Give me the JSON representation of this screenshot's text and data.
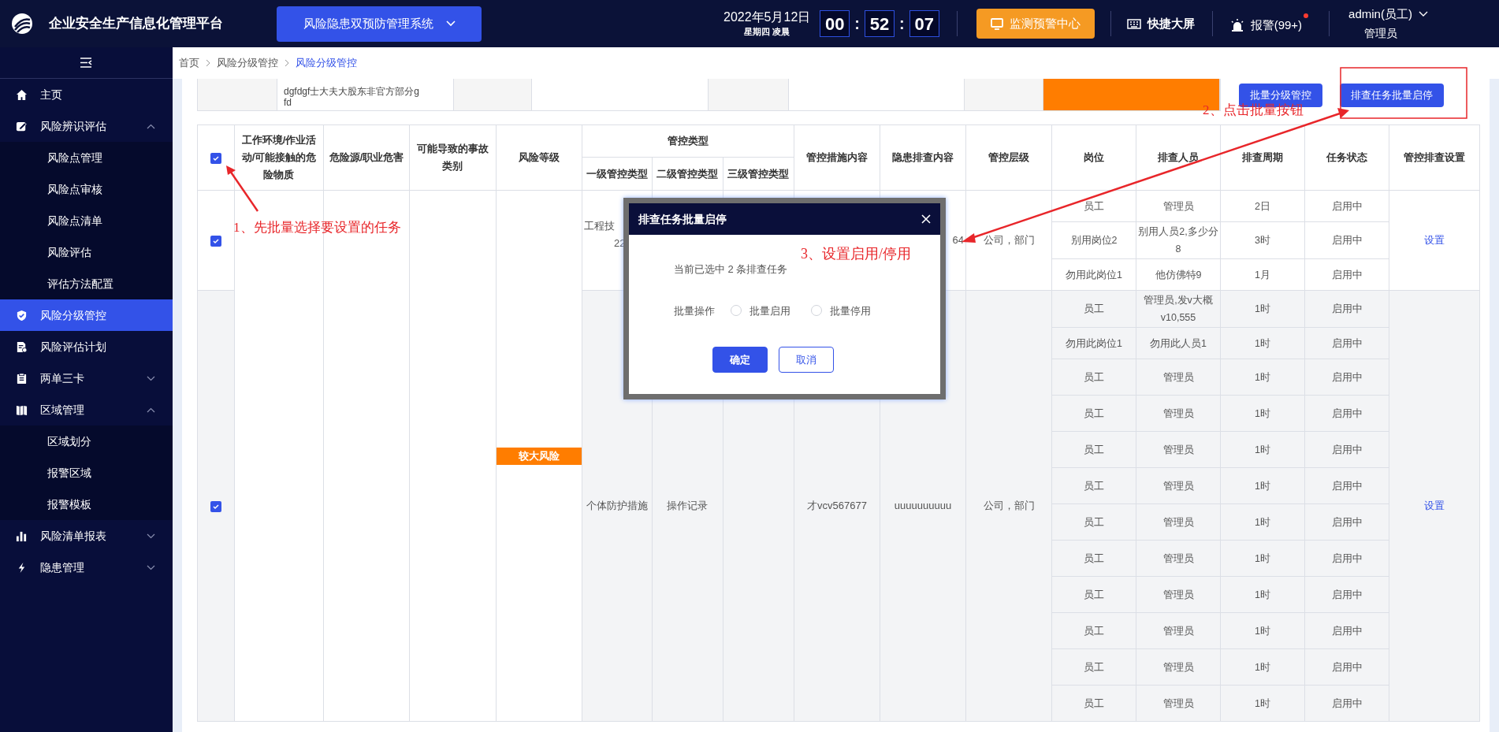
{
  "header": {
    "title": "企业安全生产信息化管理平台",
    "system_selector": {
      "label": "风险隐患双预防管理系统"
    },
    "date": "2022年5月12日",
    "weekday": "星期四 凌晨",
    "clock": [
      "00",
      "52",
      "07"
    ],
    "clock_separator": ":",
    "monitor_button": "监测预警中心",
    "big_screen": "快捷大屏",
    "alarm": {
      "label": "报警(99+)",
      "unread": true
    },
    "user": {
      "name": "admin(员工)",
      "role": "管理员"
    }
  },
  "sidebar": {
    "items": [
      {
        "label": "主页",
        "kind": "link",
        "selected": false
      },
      {
        "label": "风险辨识评估",
        "kind": "group",
        "expanded": true,
        "selected": false,
        "children": [
          {
            "label": "风险点管理",
            "selected": false
          },
          {
            "label": "风险点审核",
            "selected": false
          },
          {
            "label": "风险点清单",
            "selected": false
          },
          {
            "label": "风险评估",
            "selected": false
          },
          {
            "label": "评估方法配置",
            "selected": false
          }
        ]
      },
      {
        "label": "风险分级管控",
        "kind": "link",
        "selected": true
      },
      {
        "label": "风险评估计划",
        "kind": "link",
        "selected": false
      },
      {
        "label": "两单三卡",
        "kind": "group",
        "expanded": false,
        "selected": false
      },
      {
        "label": "区域管理",
        "kind": "group",
        "expanded": true,
        "selected": false,
        "children": [
          {
            "label": "区域划分",
            "selected": false
          },
          {
            "label": "报警区域",
            "selected": false
          },
          {
            "label": "报警模板",
            "selected": false
          }
        ]
      },
      {
        "label": "风险清单报表",
        "kind": "group",
        "expanded": false,
        "selected": false
      },
      {
        "label": "隐患管理",
        "kind": "group",
        "expanded": false,
        "selected": false
      }
    ]
  },
  "breadcrumb": [
    {
      "label": "首页",
      "selected": false
    },
    {
      "label": "风险分级管控",
      "selected": false
    },
    {
      "label": "风险分级管控",
      "selected": true
    }
  ],
  "top_row": {
    "text_lines": [
      "dgfdgf士大夫大股东非官方部分g",
      "fd"
    ],
    "buttons": [
      "批量分级管控",
      "排查任务批量启停"
    ]
  },
  "table": {
    "select_all": {
      "checked": true
    },
    "columns": [
      {
        "label": "工作环境/作业活动/可能接触的危险物质"
      },
      {
        "label": "危险源/职业危害"
      },
      {
        "label": "可能导致的事故类别"
      },
      {
        "label": "风险等级"
      },
      {
        "label": "管控类型",
        "children": [
          {
            "label": "一级管控类型"
          },
          {
            "label": "二级管控类型"
          },
          {
            "label": "三级管控类型"
          }
        ]
      },
      {
        "label": "管控措施内容"
      },
      {
        "label": "隐患排查内容"
      },
      {
        "label": "管控层级"
      },
      {
        "label": "岗位"
      },
      {
        "label": "排查人员"
      },
      {
        "label": "排查周期"
      },
      {
        "label": "任务状态"
      },
      {
        "label": "管控排查设置"
      }
    ],
    "risk_level": {
      "label": "较大风险",
      "color": "#ff7d00"
    },
    "groups": [
      {
        "checked": true,
        "highlighted": false,
        "type_1": [
          "工程技",
          "22"
        ],
        "check_content": "64",
        "level": "公司，部门",
        "settings": "设置",
        "rows": [
          {
            "post": "员工",
            "person": "管理员",
            "period": "2日",
            "status": "启用中"
          },
          {
            "post": "别用岗位2",
            "person": "别用人员2,多少分8",
            "period": "3时",
            "status": "启用中"
          },
          {
            "post": "勿用此岗位1",
            "person": "他仿佛特9",
            "period": "1月",
            "status": "启用中"
          }
        ]
      },
      {
        "checked": true,
        "highlighted": true,
        "type_1": [
          "个体防护措施"
        ],
        "type_2": "操作记录",
        "measure": "才vcv567677",
        "check_content": "uuuuuuuuuu",
        "level": "公司，部门",
        "settings": "设置",
        "rows": [
          {
            "post": "员工",
            "person": "管理员,发v大概v10,555",
            "period": "1时",
            "status": "启用中"
          },
          {
            "post": "勿用此岗位1",
            "person": "勿用此人员1",
            "period": "1时",
            "status": "启用中"
          },
          {
            "post": "员工",
            "person": "管理员",
            "period": "1时",
            "status": "启用中"
          },
          {
            "post": "员工",
            "person": "管理员",
            "period": "1时",
            "status": "启用中"
          },
          {
            "post": "员工",
            "person": "管理员",
            "period": "1时",
            "status": "启用中"
          },
          {
            "post": "员工",
            "person": "管理员",
            "period": "1时",
            "status": "启用中"
          },
          {
            "post": "员工",
            "person": "管理员",
            "period": "1时",
            "status": "启用中"
          },
          {
            "post": "员工",
            "person": "管理员",
            "period": "1时",
            "status": "启用中"
          },
          {
            "post": "员工",
            "person": "管理员",
            "period": "1时",
            "status": "启用中"
          },
          {
            "post": "员工",
            "person": "管理员",
            "period": "1时",
            "status": "启用中"
          },
          {
            "post": "员工",
            "person": "管理员",
            "period": "1时",
            "status": "启用中"
          },
          {
            "post": "员工",
            "person": "管理员",
            "period": "1时",
            "status": "启用中"
          }
        ]
      }
    ]
  },
  "dialog": {
    "title": "排查任务批量启停",
    "message": "当前已选中 2 条排查任务",
    "field_label": "批量操作",
    "options": [
      {
        "label": "批量启用",
        "selected": false
      },
      {
        "label": "批量停用",
        "selected": false
      }
    ],
    "buttons": [
      {
        "label": "确定",
        "kind": "primary"
      },
      {
        "label": "取消",
        "kind": "secondary"
      }
    ]
  },
  "annotations": [
    {
      "text": "1、先批量选择要设置的任务"
    },
    {
      "text": "2、点击批量按钮"
    },
    {
      "text": "3、设置启用/停用"
    }
  ]
}
